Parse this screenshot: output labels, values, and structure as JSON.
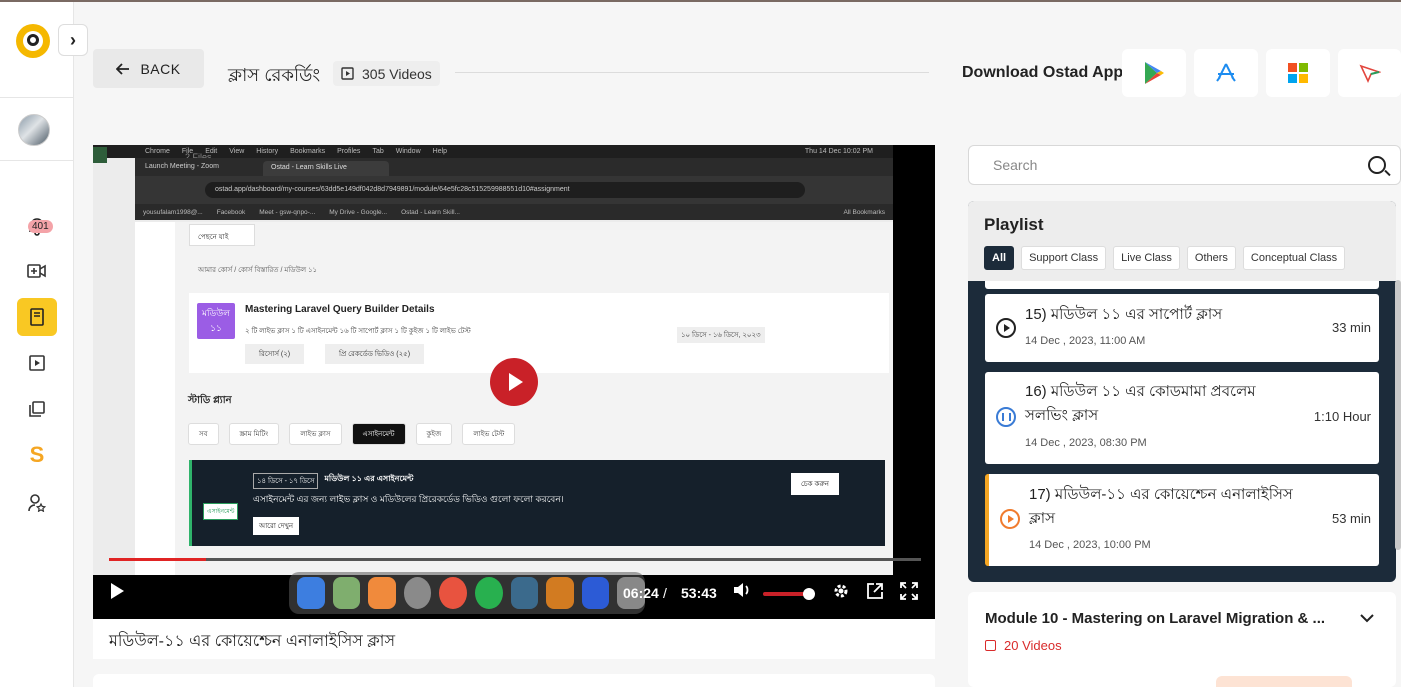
{
  "app": {
    "name": "Ostad"
  },
  "sidebar": {
    "notification_count": "401",
    "items": [
      {
        "icon": "bell-icon"
      },
      {
        "icon": "video-add-icon"
      },
      {
        "icon": "book-icon",
        "active": true
      },
      {
        "icon": "play-square-icon"
      },
      {
        "icon": "copy-icon"
      },
      {
        "icon": "s-brand-icon"
      },
      {
        "icon": "user-star-icon"
      }
    ]
  },
  "header": {
    "back_label": "BACK",
    "page_title": "ক্লাস রেকর্ডিং",
    "video_count": "305 Videos",
    "download_label": "Download Ostad App",
    "stores": [
      "google-play-icon",
      "app-store-icon",
      "microsoft-store-icon",
      "apk-icon"
    ]
  },
  "player": {
    "current_time": "06:24",
    "separator": "/",
    "total_time": "53:43",
    "progress_fraction": 0.12,
    "volume_fraction": 1.0,
    "embedded_screen": {
      "mac_menu": [
        "Chrome",
        "File",
        "Edit",
        "View",
        "History",
        "Bookmarks",
        "Profiles",
        "Tab",
        "Window",
        "Help"
      ],
      "clock": "Thu 14 Dec 10:02 PM",
      "files_label": "2 Files",
      "tab1": "Launch Meeting - Zoom",
      "tab2": "Ostad - Learn Skills Live",
      "url": "ostad.app/dashboard/my-courses/63dd5e149df042d8d7949891/module/64e5fc28c515259988551d10#assignment",
      "bookmarks": [
        "yousufalam1998@...",
        "Facebook",
        "Meet - gsw-qnpo-...",
        "My Drive - Google...",
        "Ostad - Learn Skill..."
      ],
      "all_bookmarks": "All Bookmarks",
      "back": "পেছনে যাই",
      "breadcrumb": "আমার কোর্স / কোর্স বিস্তারিত / মডিউল ১১",
      "module_badge": "মডিউল ১১",
      "module_title": "Mastering Laravel Query Builder Details",
      "module_meta": "২ টি লাইভ ক্লাস   ১ টি এসাইনমেন্ট   ১৬ টি সাপোর্ট ক্লাস   ১ টি কুইজ   ১ টি লাইভ টেস্ট",
      "dates": "১০ ডিসে - ১৬ ডিসে, ২০২৩",
      "resource_btn": "রিসোর্স (২)",
      "prerecorded_btn": "প্রি রেকর্ডেড ভিডিও (২৫)",
      "study_plan": "স্টাডি প্ল্যান",
      "tabs": [
        "সব",
        "স্ক্রাম মিটিং",
        "লাইভ ক্লাস",
        "এসাইনমেন্ট",
        "কুইজ",
        "লাইভ টেস্ট"
      ],
      "assign_date": "১৪ ডিসে - ১৭ ডিসে",
      "assign_title": "মডিউল ১১ এর এসাইনমেন্ট",
      "assign_desc": "এসাইনমেন্ট এর জন্য লাইভ ক্লাস ও মডিউলের প্রিরেকর্ডেড ভিডিও গুলো ফলো করবেন।",
      "assign_more": "আরো দেখুন",
      "assign_check": "চেক করুন",
      "assign_tag": "এসাইনমেন্ট"
    }
  },
  "video_title": "মডিউল-১১ এর কোয়েশ্চেন এনালাইসিস ক্লাস",
  "search": {
    "placeholder": "Search"
  },
  "playlist": {
    "title": "Playlist",
    "filters": [
      "All",
      "Support Class",
      "Live Class",
      "Others",
      "Conceptual Class"
    ],
    "items": [
      {
        "title": "15) মডিউল ১১ এর সাপোর্ট ক্লাস",
        "date": "14 Dec , 2023,  11:00 AM",
        "duration": "33 min",
        "state": "play-icon"
      },
      {
        "title": "16) মডিউল ১১ এর কোডমামা প্রবলেম সলভিং ক্লাস",
        "date": "14 Dec , 2023,  08:30 PM",
        "duration": "1:10 Hour",
        "state": "pause-icon"
      },
      {
        "title": "17) মডিউল-১১  এর কোয়েশ্চেন এনালাইসিস ক্লাস",
        "date": "14 Dec , 2023,  10:00 PM",
        "duration": "53 min",
        "state": "playing-icon"
      }
    ]
  },
  "module": {
    "title": "Module 10 - Mastering on Laravel Migration & ...",
    "count": "20 Videos"
  },
  "colors": {
    "accent": "#f9c823",
    "brand_red": "#c92128",
    "playlist_bg": "#1c2b3a"
  }
}
